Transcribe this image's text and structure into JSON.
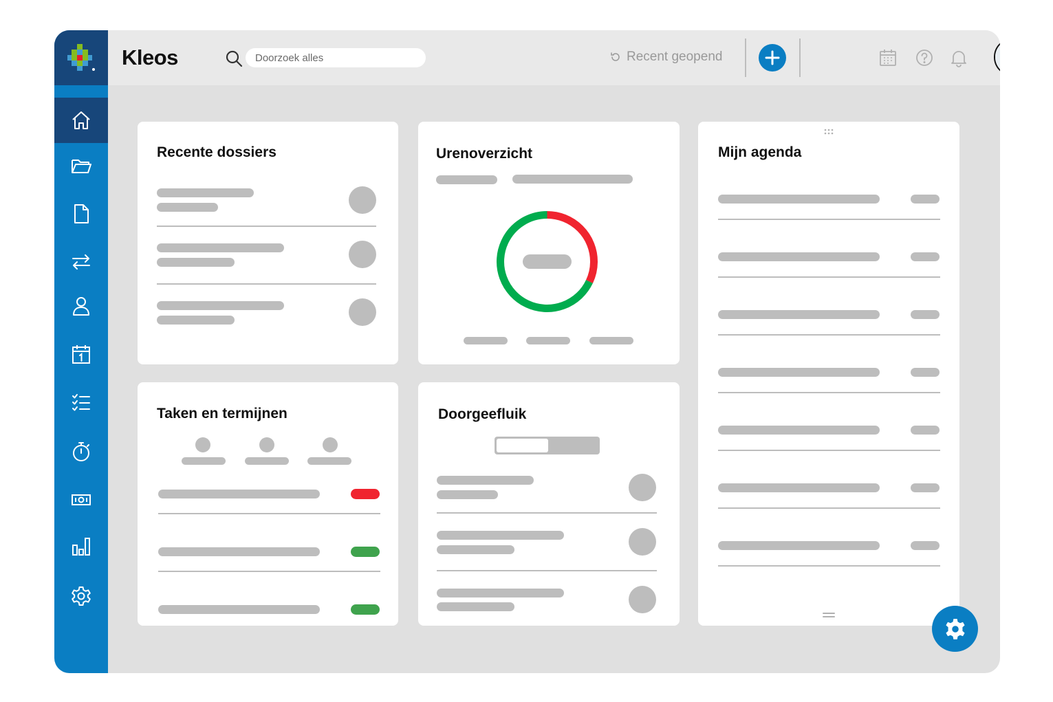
{
  "header": {
    "app_title": "Kleos",
    "search_placeholder": "Doorzoek alles",
    "recent_label": "Recent geopend"
  },
  "sidebar": {
    "items": [
      {
        "icon": "home-icon"
      },
      {
        "icon": "folder-icon"
      },
      {
        "icon": "document-icon"
      },
      {
        "icon": "transfer-icon"
      },
      {
        "icon": "user-icon"
      },
      {
        "icon": "calendar-icon"
      },
      {
        "icon": "tasks-icon"
      },
      {
        "icon": "stopwatch-icon"
      },
      {
        "icon": "money-icon"
      },
      {
        "icon": "bar-chart-icon"
      },
      {
        "icon": "settings-icon"
      }
    ]
  },
  "widgets": {
    "recent_dossiers": {
      "title": "Recente dossiers"
    },
    "hours_overview": {
      "title": "Urenoverzicht",
      "donut": {
        "red_fraction": 0.32,
        "green_fraction": 0.68
      }
    },
    "my_agenda": {
      "title": "Mijn agenda"
    },
    "tasks": {
      "title": "Taken en termijnen",
      "status_colors": [
        "#f0242f",
        "#3fa34d",
        "#3fa34d"
      ]
    },
    "passthrough": {
      "title": "Doorgeefluik"
    }
  },
  "colors": {
    "brand_blue": "#0a7ec3",
    "brand_dark_blue": "#17467a",
    "placeholder_gray": "#bdbdbd",
    "red": "#f0242f",
    "green": "#00ac4e"
  }
}
